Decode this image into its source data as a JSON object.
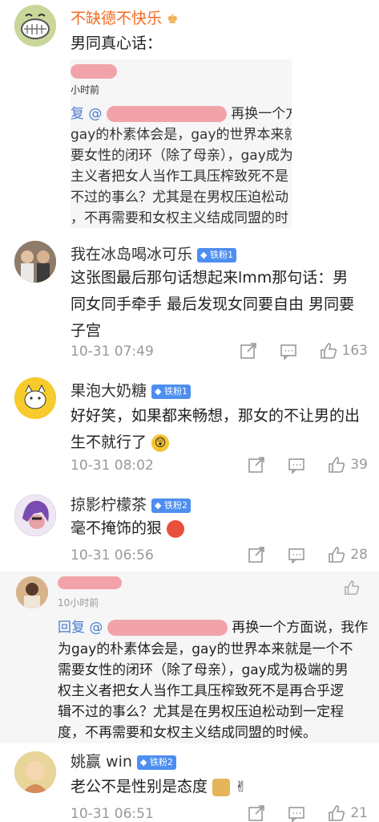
{
  "comments": [
    {
      "nick": "不缺德不快乐",
      "text": "男同真心话：",
      "embedded": {
        "time": "小时前",
        "reply_prefix": "复 @",
        "reply_cut": "再换一个方面",
        "lines": [
          "gay的朴素体会是，gay的世界本来就",
          "要女性的闭环（除了母亲），gay成为",
          "主义者把女人当作工具压榨致死不是",
          "不过的事么？尤其是在男权压迫松动",
          "，不再需要和女权主义结成同盟的时"
        ]
      }
    },
    {
      "nick": "我在冰岛喝冰可乐",
      "badge": "铁粉1",
      "text_lines": [
        "这张图最后那句话想起来lmm那句话：男",
        "同女同手牵手 最后发现女同要自由 男同要",
        "子宫"
      ],
      "time": "10-31 07:49",
      "likes": "163"
    },
    {
      "nick": "果泡大奶糖",
      "badge": "铁粉1",
      "text_lines": [
        "好好笑，如果都来畅想，那女的不让男的出",
        "生不就行了"
      ],
      "time": "10-31 08:02",
      "likes": "39"
    },
    {
      "nick": "掠影柠檬茶",
      "badge": "铁粉2",
      "text_lines": [
        "毫不掩饰的狠"
      ],
      "time": "10-31 06:56",
      "likes": "28"
    },
    {
      "embedded_time": "10小时前",
      "reply_prefix": "回复 @",
      "reply_cut": "再换一个方面说，我作",
      "lines": [
        "为gay的朴素体会是，gay的世界本来就是一个不",
        "需要女性的闭环（除了母亲），gay成为极端的男",
        "权主义者把女人当作工具压榨致死不是再合乎逻",
        "辑不过的事么？尤其是在男权压迫松动到一定程",
        "度，不再需要和女权主义结成同盟的时候。"
      ]
    },
    {
      "nick": "姚赢 win",
      "badge": "铁粉2",
      "text_lines": [
        "老公不是性别是态度"
      ],
      "time": "10-31 06:51",
      "likes": "21"
    }
  ]
}
